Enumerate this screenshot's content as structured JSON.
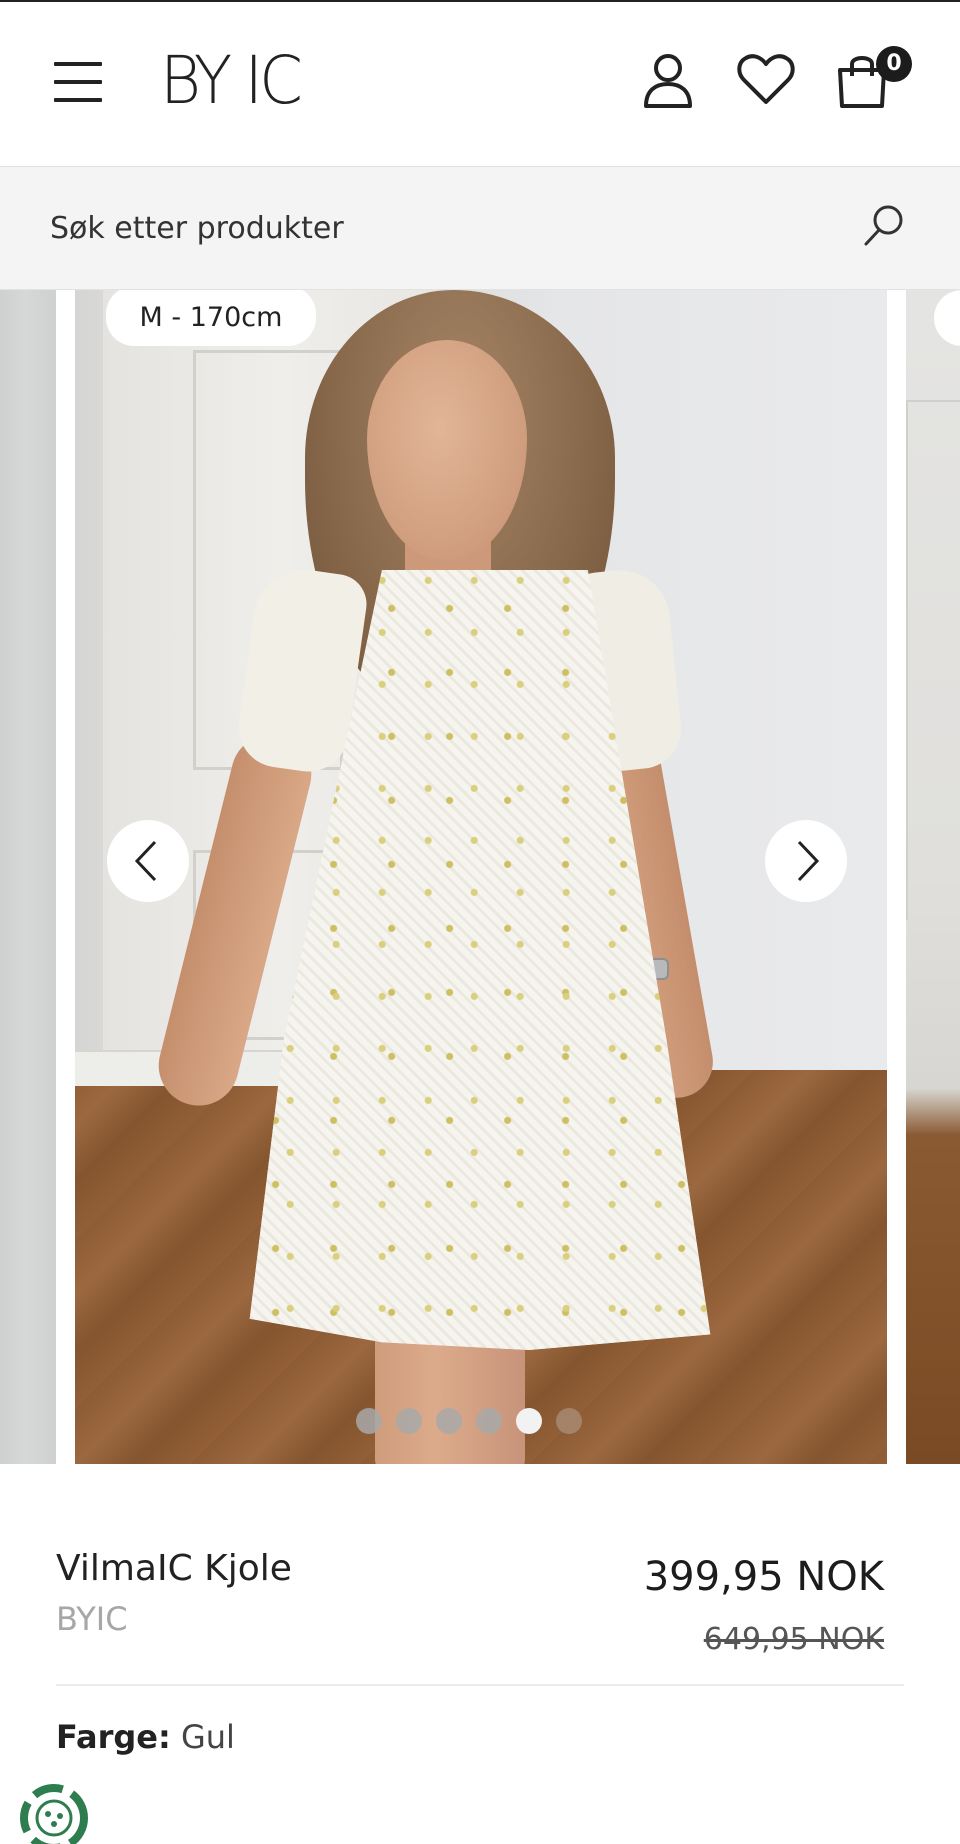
{
  "header": {
    "logo_text": "BY IC",
    "cart_count": "0"
  },
  "search": {
    "placeholder": "Søk etter produkter"
  },
  "gallery": {
    "size_badge": "M - 170cm",
    "total_images": 6,
    "active_image_index": 4
  },
  "product": {
    "name": "VilmaIC Kjole",
    "brand": "BYIC",
    "price": "399,95 NOK",
    "original_price": "649,95 NOK",
    "color_label": "Farge:",
    "color_value": "Gul"
  },
  "icons": {
    "menu": "hamburger-menu-icon",
    "account": "user-icon",
    "wishlist": "heart-icon",
    "cart": "shopping-bag-icon",
    "search": "search-icon",
    "prev": "chevron-left-icon",
    "next": "chevron-right-icon",
    "eco": "recycle-badge-icon"
  },
  "colors": {
    "text_primary": "#222222",
    "text_muted": "#a7a7a7",
    "search_bg": "#f4f4f4",
    "badge_bg": "#1c1c1c",
    "eco_green": "#2e7d4f"
  }
}
